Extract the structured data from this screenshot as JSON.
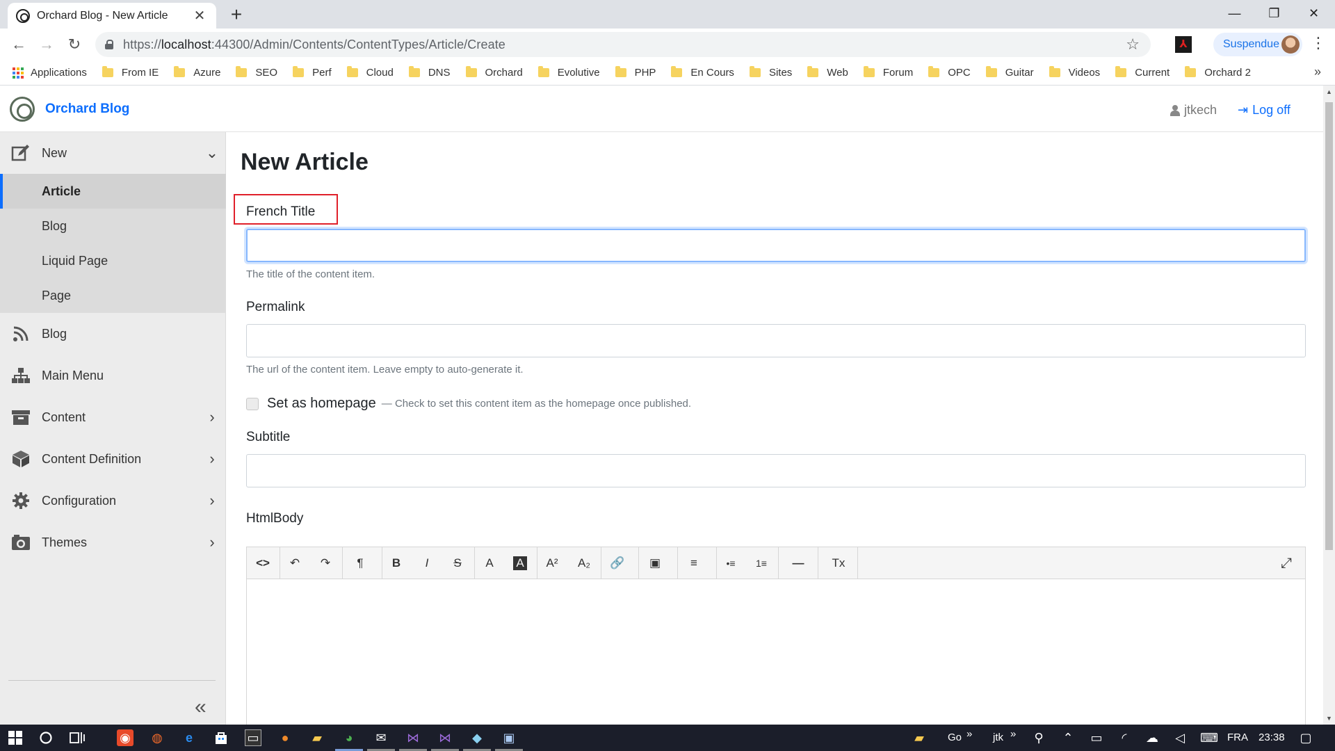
{
  "browser": {
    "tab_title": "Orchard Blog - New Article",
    "tab_close": "✕",
    "new_tab": "+",
    "url_prefix": "https://",
    "url_host": "localhost",
    "url_rest": ":44300/Admin/Contents/ContentTypes/Article/Create",
    "profile_label": "Suspendue",
    "window_controls": [
      "—",
      "❐",
      "✕"
    ]
  },
  "bookmarks": {
    "apps_label": "Applications",
    "items": [
      "From IE",
      "Azure",
      "SEO",
      "Perf",
      "Cloud",
      "DNS",
      "Orchard",
      "Evolutive",
      "PHP",
      "En Cours",
      "Sites",
      "Web",
      "Forum",
      "OPC",
      "Guitar",
      "Videos",
      "Current",
      "Orchard 2"
    ],
    "more": "»"
  },
  "header": {
    "brand": "Orchard Blog",
    "user": "jtkech",
    "logoff": "Log off"
  },
  "sidebar": {
    "new_label": "New",
    "sub_items": [
      "Article",
      "Blog",
      "Liquid Page",
      "Page"
    ],
    "active_sub": "Article",
    "items": [
      {
        "label": "Blog",
        "icon": "rss-icon",
        "chevron": false
      },
      {
        "label": "Main Menu",
        "icon": "sitemap-icon",
        "chevron": false
      },
      {
        "label": "Content",
        "icon": "archive-icon",
        "chevron": true
      },
      {
        "label": "Content Definition",
        "icon": "cube-icon",
        "chevron": true
      },
      {
        "label": "Configuration",
        "icon": "cog-icon",
        "chevron": true
      },
      {
        "label": "Themes",
        "icon": "camera-icon",
        "chevron": true
      }
    ],
    "collapse": "«"
  },
  "main": {
    "page_title": "New Article",
    "title_field": {
      "label": "French Title",
      "value": "",
      "hint": "The title of the content item."
    },
    "permalink_field": {
      "label": "Permalink",
      "value": "",
      "hint": "The url of the content item. Leave empty to auto-generate it."
    },
    "homepage": {
      "label": "Set as homepage",
      "hint": "— Check to set this content item as the homepage once published.",
      "checked": false
    },
    "subtitle_field": {
      "label": "Subtitle",
      "value": ""
    },
    "htmlbody": {
      "label": "HtmlBody",
      "toolbar": [
        "<>",
        "↶",
        "↷",
        "¶",
        "B",
        "I",
        "S",
        "A",
        "A",
        "A²",
        "A₂",
        "🔗",
        "▣",
        "≡",
        "•≡",
        "1≡",
        "—",
        "Tx",
        "⤢"
      ]
    }
  },
  "taskbar": {
    "go": "Go",
    "jtk": "jtk",
    "lang": "FRA",
    "time": "23:38"
  },
  "colors": {
    "accent": "#0d6efd",
    "highlight_box": "#e0202a",
    "sidebar_bg": "#ececec",
    "taskbar_bg": "#1b1e2a"
  }
}
